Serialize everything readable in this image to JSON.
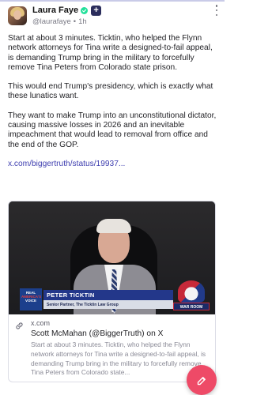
{
  "post": {
    "author": {
      "name": "Laura Faye",
      "handle": "@laurafaye",
      "time": "1h",
      "follow_label": "+"
    },
    "paragraphs": [
      "Start at about 3 minutes. Ticktin, who helped the Flynn network attorneys for Tina write a designed-to-fail appeal, is demanding Trump bring in the military to forcefully remove Tina Peters from Colorado state prison.",
      "This would end Trump's presidency, which is exactly what these lunatics want.",
      "They want to make Trump into an unconstitutional dictator, causing massive losses in 2026 and an inevitable impeachment that would lead to removal from office and the end of the GOP."
    ],
    "link_text": "x.com/biggertruth/status/19937..."
  },
  "card": {
    "video": {
      "logo_text": [
        "REAL",
        "AMERICA'S",
        "VOICE"
      ],
      "lower_third_name": "PETER TICKTIN",
      "lower_third_title": "Senior Partner, The Ticktin Law Group",
      "network_label": "WAR ROOM"
    },
    "domain": "x.com",
    "title": "Scott McMahan (@BiggerTruth) on X",
    "description": "Start at about 3 minutes. Ticktin, who helped the Flynn network attorneys for Tina write a designed-to-fail appeal, is demanding Trump bring in the military to forcefully remove Tina Peters from Colorado state..."
  },
  "colors": {
    "link": "#3f3fb0",
    "fab": "#ee4a67",
    "verified": "#23e09b",
    "follow": "#2b2d5c"
  },
  "icons": [
    "verified-badge-icon",
    "more-options-icon",
    "link-icon",
    "compose-icon"
  ]
}
